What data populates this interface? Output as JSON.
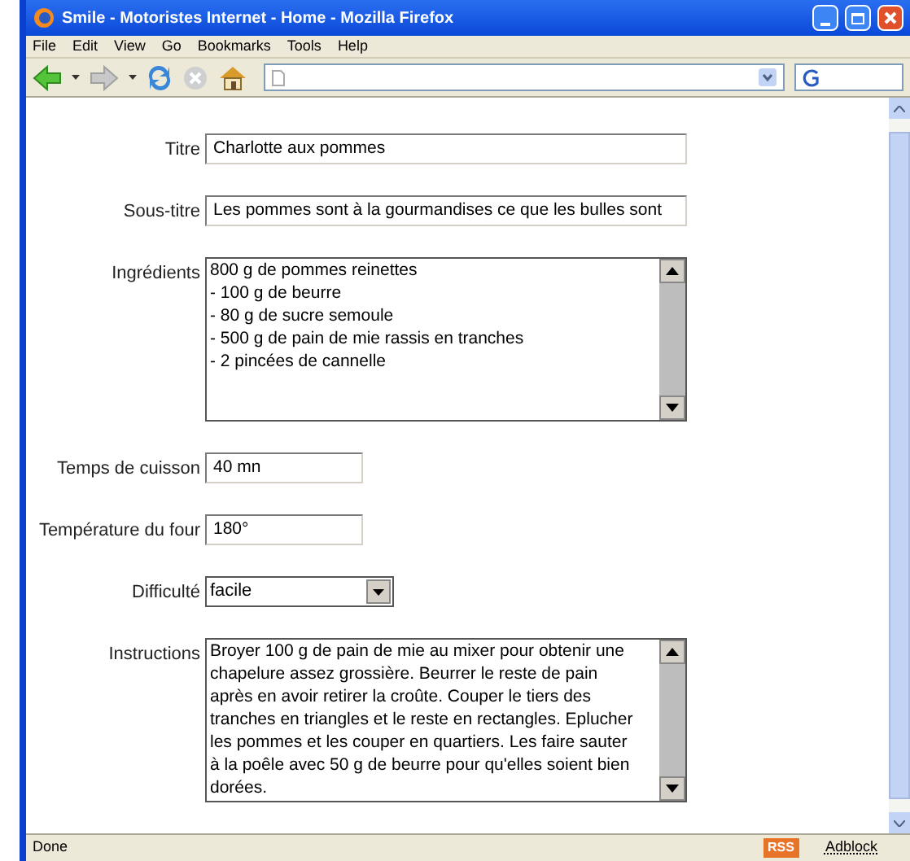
{
  "window": {
    "title": "Smile - Motoristes Internet - Home - Mozilla Firefox"
  },
  "menu": [
    "File",
    "Edit",
    "View",
    "Go",
    "Bookmarks",
    "Tools",
    "Help"
  ],
  "form": [
    {
      "kind": "text",
      "label": "Titre",
      "value": "Charlotte aux pommes"
    },
    {
      "kind": "text",
      "label": "Sous-titre",
      "value": "Les pommes sont à la gourmandises ce que les bulles sont"
    },
    {
      "kind": "textarea",
      "label": "Ingrédients",
      "value": "800 g de pommes reinettes\n- 100 g de beurre\n- 80 g de sucre semoule\n- 500 g de pain de mie rassis en tranches\n- 2 pincées de cannelle"
    },
    {
      "kind": "short",
      "label": "Temps de cuisson",
      "value": "40 mn"
    },
    {
      "kind": "short",
      "label": "Température du four",
      "value": "180°"
    },
    {
      "kind": "select",
      "label": "Difficulté",
      "value": "facile"
    },
    {
      "kind": "textarea",
      "label": "Instructions",
      "value": "Broyer 100 g de pain de mie au mixer pour obtenir une chapelure assez grossière. Beurrer le reste de pain après en avoir retirer la croûte. Couper le tiers des tranches en triangles et le reste en rectangles. Eplucher les pommes et les couper en quartiers. Les faire sauter à la poêle avec 50 g de beurre pour qu'elles soient bien dorées."
    }
  ],
  "status_bar": {
    "text": "Done",
    "badge": "RSS",
    "addon": "Adblock"
  }
}
